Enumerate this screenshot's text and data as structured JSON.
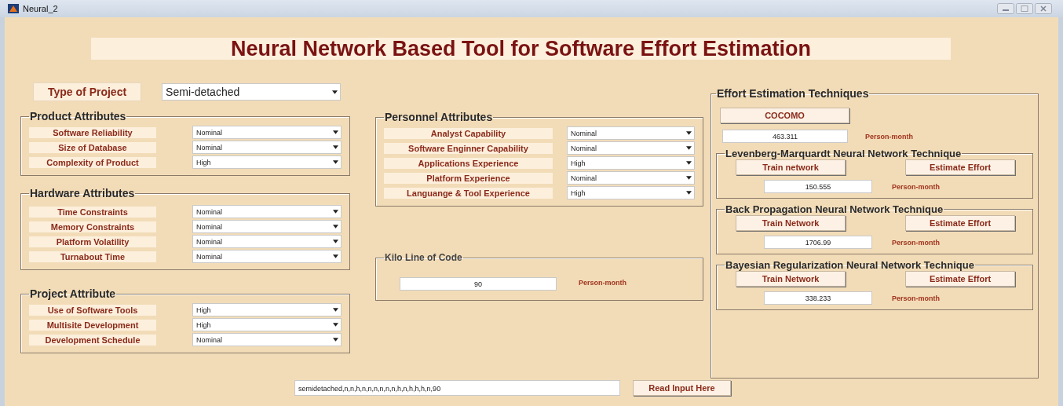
{
  "window": {
    "title": "Neural_2"
  },
  "heading": "Neural Network Based Tool for Software Effort Estimation",
  "project_type": {
    "label": "Type of Project",
    "value": "Semi-detached"
  },
  "left_groups": [
    {
      "title": "Product Attributes",
      "rows": [
        {
          "label": "Software Reliability",
          "value": "Nominal"
        },
        {
          "label": "Size of Database",
          "value": "Nominal"
        },
        {
          "label": "Complexity of Product",
          "value": "High"
        }
      ]
    },
    {
      "title": "Hardware Attributes",
      "rows": [
        {
          "label": "Time Constraints",
          "value": "Nominal"
        },
        {
          "label": "Memory Constraints",
          "value": "Nominal"
        },
        {
          "label": "Platform Volatility",
          "value": "Nominal"
        },
        {
          "label": "Turnabout Time",
          "value": "Nominal"
        }
      ]
    },
    {
      "title": "Project Attribute",
      "rows": [
        {
          "label": "Use of Software Tools",
          "value": "High"
        },
        {
          "label": "Multisite Development",
          "value": "High"
        },
        {
          "label": "Development Schedule",
          "value": "Nominal"
        }
      ]
    }
  ],
  "personnel": {
    "title": "Personnel Attributes",
    "rows": [
      {
        "label": "Analyst Capability",
        "value": "Nominal"
      },
      {
        "label": "Software Enginner Capability",
        "value": "Nominal"
      },
      {
        "label": "Applications Experience",
        "value": "High"
      },
      {
        "label": "Platform Experience",
        "value": "Nominal"
      },
      {
        "label": "Languange & Tool Experience",
        "value": "High"
      }
    ]
  },
  "kloc": {
    "title": "Kilo Line of Code",
    "value": "90",
    "unit": "Person-month"
  },
  "effort": {
    "title": "Effort Estimation Techniques",
    "cocomo": {
      "button": "COCOMO",
      "value": "463.311",
      "unit": "Person-month"
    },
    "techniques": [
      {
        "title": "Levenberg-Marquardt Neural Network Technique",
        "train_button": "Train network",
        "estimate_button": "Estimate Effort",
        "value": "150.555",
        "unit": "Person-month"
      },
      {
        "title": "Back Propagation Neural Network Technique",
        "train_button": "Train Network",
        "estimate_button": "Estimate Effort",
        "value": "1706.99",
        "unit": "Person-month"
      },
      {
        "title": "Bayesian Regularization Neural Network Technique",
        "train_button": "Train Network",
        "estimate_button": "Estimate Effort",
        "value": "338.233",
        "unit": "Person-month"
      }
    ]
  },
  "input": {
    "value": "semidetached,n,n,h,n,n,n,n,n,n,h,n,h,h,h,n,90",
    "button": "Read Input Here"
  }
}
